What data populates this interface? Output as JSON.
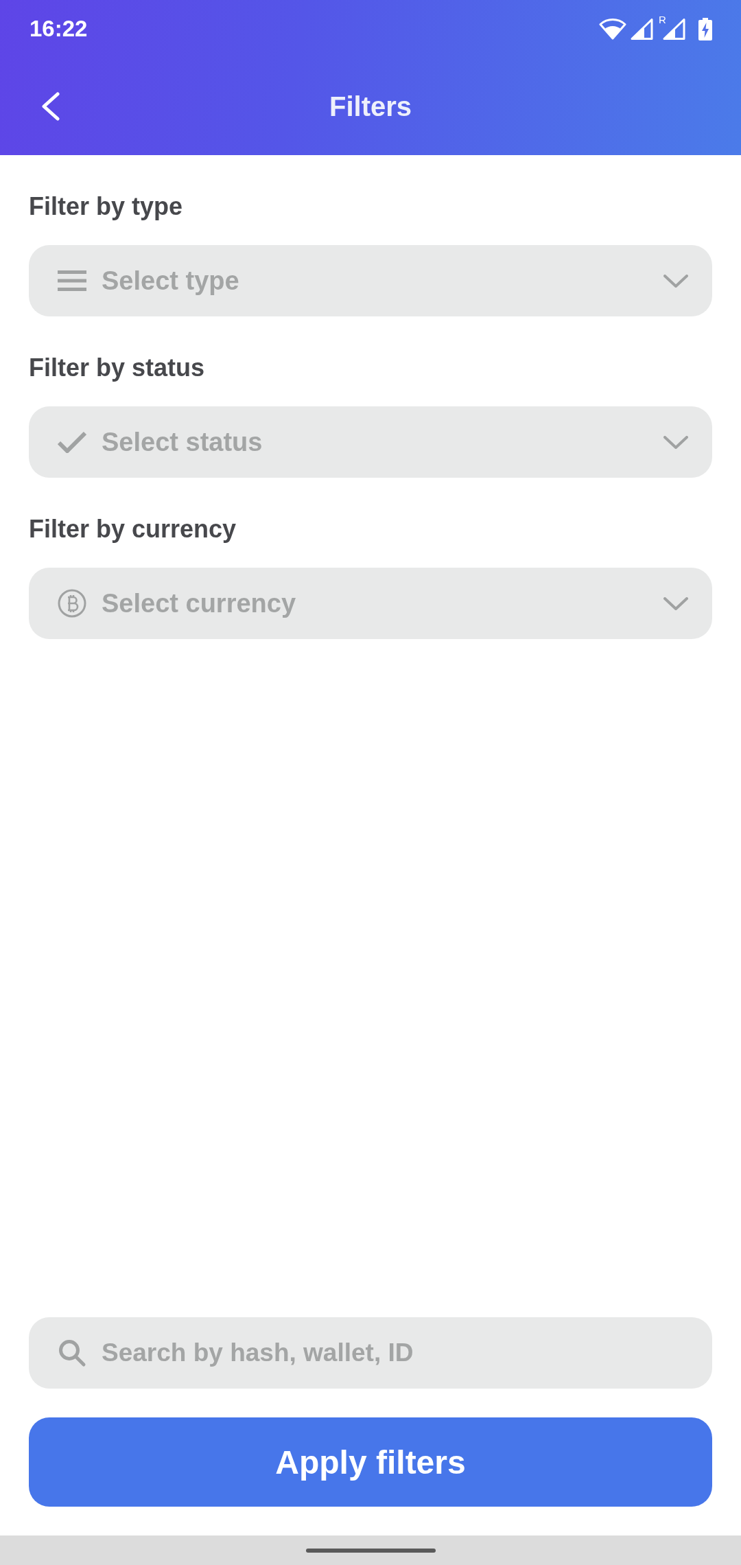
{
  "status_bar": {
    "time": "16:22",
    "roaming_label": "R"
  },
  "header": {
    "title": "Filters"
  },
  "filters": [
    {
      "kind": "type",
      "label": "Filter by type",
      "placeholder": "Select type"
    },
    {
      "kind": "status",
      "label": "Filter by status",
      "placeholder": "Select status"
    },
    {
      "kind": "currency",
      "label": "Filter by currency",
      "placeholder": "Select currency"
    }
  ],
  "search": {
    "placeholder": "Search by hash, wallet, ID"
  },
  "apply_button": {
    "label": "Apply filters"
  }
}
